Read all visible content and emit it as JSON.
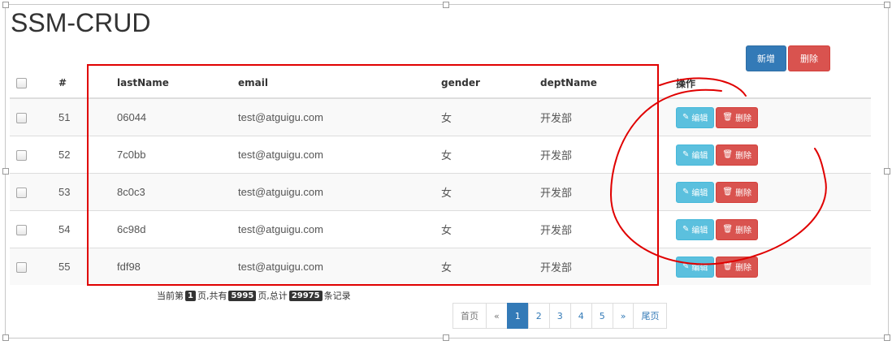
{
  "page_title": "SSM-CRUD",
  "toolbar": {
    "add_label": "新增",
    "delete_label": "删除"
  },
  "table": {
    "headers": [
      "#",
      "lastName",
      "email",
      "gender",
      "deptName",
      "操作"
    ],
    "rows": [
      {
        "id": "51",
        "lastName": "06044",
        "email": "test@atguigu.com",
        "gender": "女",
        "deptName": "开发部"
      },
      {
        "id": "52",
        "lastName": "7c0bb",
        "email": "test@atguigu.com",
        "gender": "女",
        "deptName": "开发部"
      },
      {
        "id": "53",
        "lastName": "8c0c3",
        "email": "test@atguigu.com",
        "gender": "女",
        "deptName": "开发部"
      },
      {
        "id": "54",
        "lastName": "6c98d",
        "email": "test@atguigu.com",
        "gender": "女",
        "deptName": "开发部"
      },
      {
        "id": "55",
        "lastName": "fdf98",
        "email": "test@atguigu.com",
        "gender": "女",
        "deptName": "开发部"
      }
    ],
    "edit_label": "编辑",
    "remove_label": "删除"
  },
  "pageinfo": {
    "prefix": "当前第",
    "current": "1",
    "mid1": "页,共有",
    "total_pages": "5995",
    "mid2": "页,总计",
    "total_records": "29975",
    "suffix": "条记录"
  },
  "pagination": {
    "first": "首页",
    "prev": "«",
    "pages": [
      "1",
      "2",
      "3",
      "4",
      "5"
    ],
    "next": "»",
    "last": "尾页",
    "active": "1"
  },
  "colors": {
    "primary": "#337ab7",
    "danger": "#d9534f",
    "info": "#5bc0de",
    "annotation": "#e00000"
  }
}
